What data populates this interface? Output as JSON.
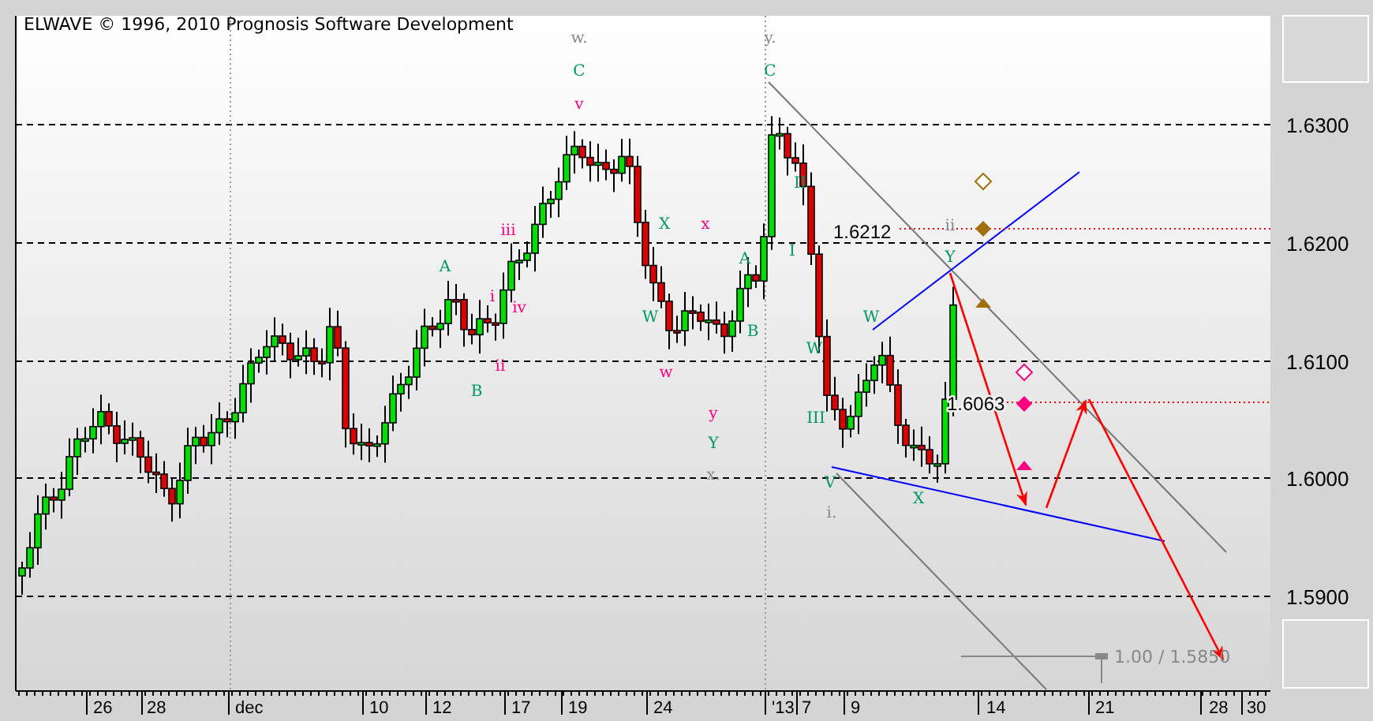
{
  "chart": {
    "title": "ELWAVE © 1996, 2010 Prognosis Software Development",
    "y_axis": {
      "labels": [
        "1.6300",
        "1.6200",
        "1.6100",
        "1.6000",
        "1.5900"
      ]
    },
    "x_axis": {
      "labels": [
        "26",
        "28",
        "dec",
        "10",
        "12",
        "17",
        "19",
        "24",
        "'13",
        "7",
        "9",
        "14",
        "21",
        "28",
        "30"
      ]
    },
    "wave_labels": [
      {
        "text": "w.",
        "color": "#888888"
      },
      {
        "text": "C",
        "color": "#009966"
      },
      {
        "text": "v",
        "color": "#ff0080"
      },
      {
        "text": "iii",
        "color": "#ff0080"
      },
      {
        "text": "A",
        "color": "#009966"
      },
      {
        "text": "i",
        "color": "#ff0080"
      },
      {
        "text": "iv",
        "color": "#ff0080"
      },
      {
        "text": "ii",
        "color": "#ff0080"
      },
      {
        "text": "B",
        "color": "#009966"
      },
      {
        "text": "X",
        "color": "#009966"
      },
      {
        "text": "W",
        "color": "#009966"
      },
      {
        "text": "w",
        "color": "#ff0080"
      },
      {
        "text": "x",
        "color": "#ff0080"
      },
      {
        "text": "A",
        "color": "#009966"
      },
      {
        "text": "B",
        "color": "#009966"
      },
      {
        "text": "y",
        "color": "#ff0080"
      },
      {
        "text": "Y",
        "color": "#009966"
      },
      {
        "text": "x.",
        "color": "#888888"
      },
      {
        "text": "y.",
        "color": "#888888"
      },
      {
        "text": "C",
        "color": "#009966"
      },
      {
        "text": "II",
        "color": "#009966"
      },
      {
        "text": "I",
        "color": "#009966"
      },
      {
        "text": "W",
        "color": "#009966"
      },
      {
        "text": "III",
        "color": "#009966"
      },
      {
        "text": "V",
        "color": "#009966"
      },
      {
        "text": "i.",
        "color": "#888888"
      },
      {
        "text": "W",
        "color": "#009966"
      },
      {
        "text": "Y",
        "color": "#009966"
      },
      {
        "text": "X",
        "color": "#009966"
      },
      {
        "text": "ii",
        "color": "#888888"
      }
    ],
    "price_labels": [
      "1.6212",
      "1.6063"
    ],
    "measure_label": "1.00 / 1.5850"
  }
}
